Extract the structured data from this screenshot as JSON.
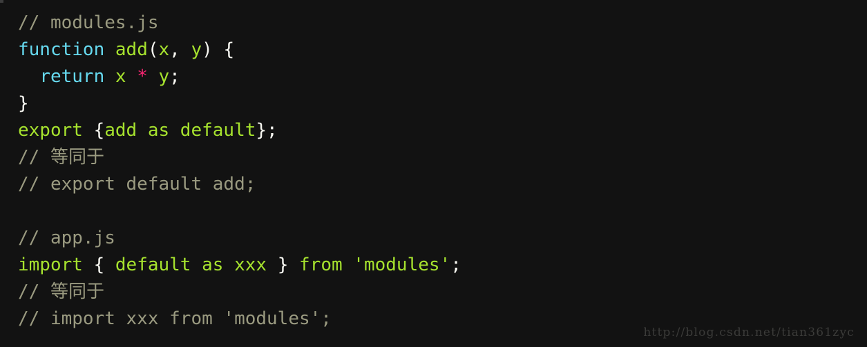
{
  "editor": {
    "theme_name": "monokai-dark",
    "background_color": "#121212",
    "language": "javascript",
    "colors": {
      "comment": "#9a9a80",
      "keyword": "#66d9ef",
      "identifier": "#a6e22e",
      "punctuation": "#f8f8f2",
      "operator": "#f92672",
      "string": "#a6e22e",
      "watermark": "#3b3b39"
    },
    "lines": [
      {
        "id": "line-1",
        "kind": "comment",
        "text": "// modules.js",
        "tokens": [
          {
            "type": "comment",
            "text": "// modules.js"
          }
        ]
      },
      {
        "id": "line-2",
        "kind": "code",
        "text": "function add(x, y) {",
        "tokens": [
          {
            "type": "keyword",
            "text": "function"
          },
          {
            "type": "punct",
            "text": " "
          },
          {
            "type": "name",
            "text": "add"
          },
          {
            "type": "punct",
            "text": "("
          },
          {
            "type": "name",
            "text": "x"
          },
          {
            "type": "punct",
            "text": ", "
          },
          {
            "type": "name",
            "text": "y"
          },
          {
            "type": "punct",
            "text": ") {"
          }
        ]
      },
      {
        "id": "line-3",
        "kind": "code",
        "text": "  return x * y;",
        "tokens": [
          {
            "type": "punct",
            "text": "  "
          },
          {
            "type": "keyword",
            "text": "return"
          },
          {
            "type": "punct",
            "text": " "
          },
          {
            "type": "name",
            "text": "x"
          },
          {
            "type": "punct",
            "text": " "
          },
          {
            "type": "operator",
            "text": "*"
          },
          {
            "type": "punct",
            "text": " "
          },
          {
            "type": "name",
            "text": "y"
          },
          {
            "type": "punct",
            "text": ";"
          }
        ]
      },
      {
        "id": "line-4",
        "kind": "code",
        "text": "}",
        "tokens": [
          {
            "type": "punct",
            "text": "}"
          }
        ]
      },
      {
        "id": "line-5",
        "kind": "code",
        "text": "export {add as default};",
        "tokens": [
          {
            "type": "name",
            "text": "export"
          },
          {
            "type": "punct",
            "text": " {"
          },
          {
            "type": "name",
            "text": "add as default"
          },
          {
            "type": "punct",
            "text": "};"
          }
        ]
      },
      {
        "id": "line-6",
        "kind": "comment",
        "text": "// 等同于",
        "tokens": [
          {
            "type": "comment",
            "text": "// "
          },
          {
            "type": "comment-cjk",
            "text": "等同于"
          }
        ]
      },
      {
        "id": "line-7",
        "kind": "comment",
        "text": "// export default add;",
        "tokens": [
          {
            "type": "comment",
            "text": "// export default add;"
          }
        ]
      },
      {
        "id": "line-8",
        "kind": "blank",
        "text": "",
        "tokens": []
      },
      {
        "id": "line-9",
        "kind": "comment",
        "text": "// app.js",
        "tokens": [
          {
            "type": "comment",
            "text": "// app.js"
          }
        ]
      },
      {
        "id": "line-10",
        "kind": "code",
        "text": "import { default as xxx } from 'modules';",
        "tokens": [
          {
            "type": "name",
            "text": "import"
          },
          {
            "type": "punct",
            "text": " { "
          },
          {
            "type": "name",
            "text": "default as xxx"
          },
          {
            "type": "punct",
            "text": " } "
          },
          {
            "type": "name",
            "text": "from"
          },
          {
            "type": "punct",
            "text": " "
          },
          {
            "type": "string",
            "text": "'modules'"
          },
          {
            "type": "punct",
            "text": ";"
          }
        ]
      },
      {
        "id": "line-11",
        "kind": "comment",
        "text": "// 等同于",
        "tokens": [
          {
            "type": "comment",
            "text": "// "
          },
          {
            "type": "comment-cjk",
            "text": "等同于"
          }
        ]
      },
      {
        "id": "line-12",
        "kind": "comment",
        "text": "// import xxx from 'modules';",
        "tokens": [
          {
            "type": "comment",
            "text": "// import xxx from 'modules';"
          }
        ]
      }
    ]
  },
  "watermark": {
    "text": "http://blog.csdn.net/tian361zyc"
  }
}
